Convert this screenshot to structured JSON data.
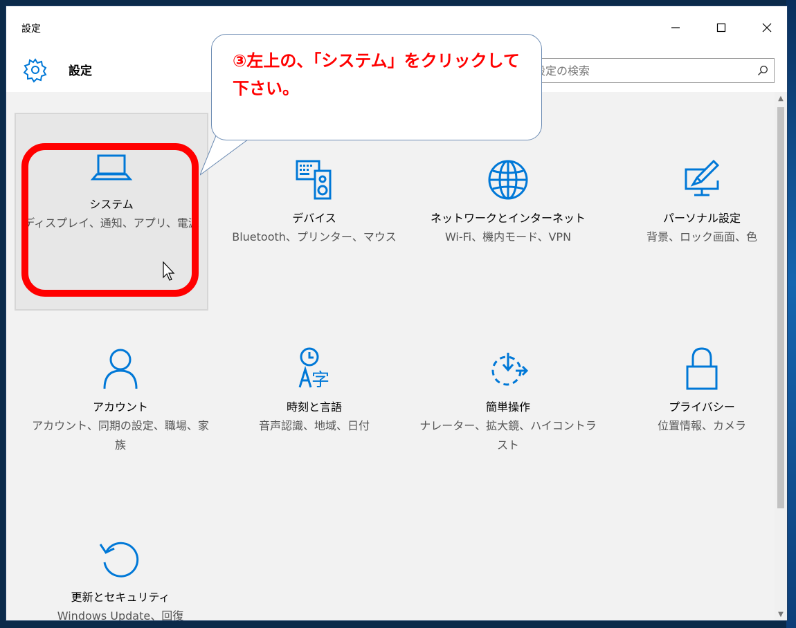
{
  "window": {
    "title": "設定",
    "controls": {
      "minimize_icon": "minimize-icon",
      "maximize_icon": "maximize-icon",
      "close_icon": "close-icon"
    }
  },
  "header": {
    "title": "設定",
    "gear_icon": "gear-icon",
    "search": {
      "value": "",
      "placeholder": "設定の検索",
      "icon": "search-icon"
    }
  },
  "tiles": [
    {
      "id": "system",
      "title": "システム",
      "desc": "ディスプレイ、通知、アプリ、電源",
      "icon": "laptop-icon"
    },
    {
      "id": "devices",
      "title": "デバイス",
      "desc": "Bluetooth、プリンター、マウス",
      "icon": "keyboard-speaker-icon"
    },
    {
      "id": "network",
      "title": "ネットワークとインターネット",
      "desc": "Wi-Fi、機内モード、VPN",
      "icon": "globe-icon"
    },
    {
      "id": "personalization",
      "title": "パーソナル設定",
      "desc": "背景、ロック画面、色",
      "icon": "paint-monitor-icon"
    },
    {
      "id": "accounts",
      "title": "アカウント",
      "desc": "アカウント、同期の設定、職場、家族",
      "icon": "person-icon"
    },
    {
      "id": "time-language",
      "title": "時刻と言語",
      "desc": "音声認識、地域、日付",
      "icon": "clock-language-icon"
    },
    {
      "id": "ease-of-access",
      "title": "簡単操作",
      "desc": "ナレーター、拡大鏡、ハイコントラスト",
      "icon": "ease-of-access-icon"
    },
    {
      "id": "privacy",
      "title": "プライバシー",
      "desc": "位置情報、カメラ",
      "icon": "lock-icon"
    },
    {
      "id": "update-security",
      "title": "更新とセキュリティ",
      "desc": "Windows Update、回復",
      "icon": "refresh-icon"
    }
  ],
  "annotation": {
    "callout_text": "③左上の、「システム」をクリックして下さい。",
    "highlight_color": "#ff0000"
  },
  "colors": {
    "accent": "#0078d7",
    "annotation_red": "#ff0000"
  }
}
